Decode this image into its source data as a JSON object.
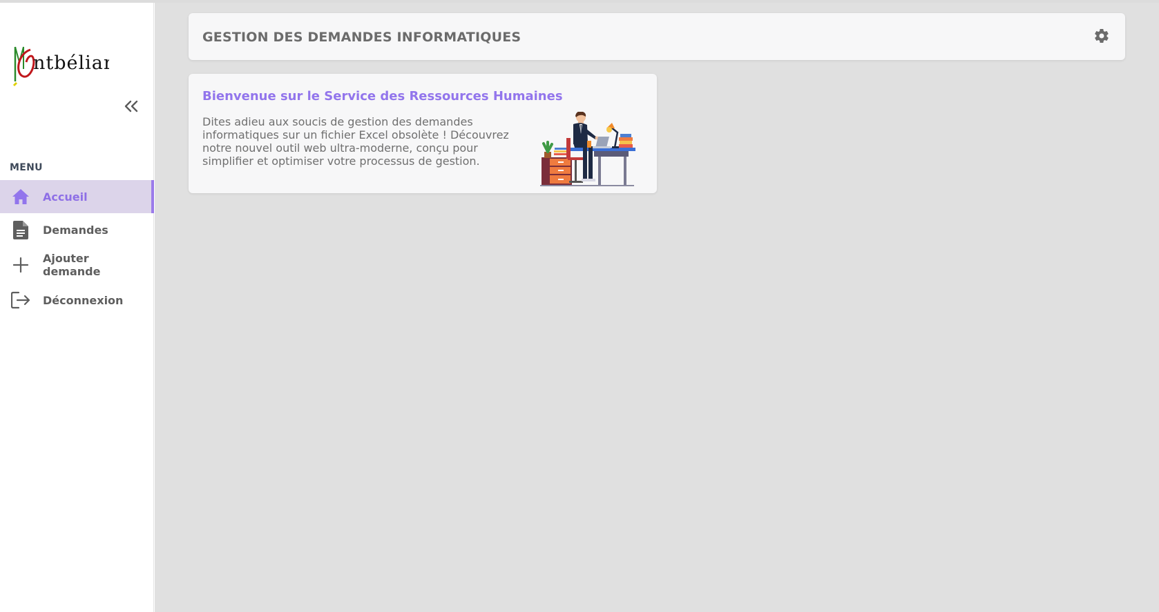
{
  "app": {
    "logo_text": "Montbéliard"
  },
  "sidebar": {
    "menu_label": "MENU",
    "collapse_icon": "double-chevron-left-icon",
    "items": [
      {
        "label": "Accueil",
        "icon": "home-icon",
        "active": true
      },
      {
        "label": "Demandes",
        "icon": "document-icon",
        "active": false
      },
      {
        "label": "Ajouter demande",
        "icon": "plus-icon",
        "active": false
      },
      {
        "label": "Déconnexion",
        "icon": "logout-icon",
        "active": false
      }
    ]
  },
  "header": {
    "title": "GESTION DES DEMANDES INFORMATIQUES",
    "settings_icon": "gear-icon"
  },
  "welcome_card": {
    "title": "Bienvenue sur le Service des Ressources Humaines",
    "text": "Dites adieu aux soucis de gestion des demandes informatiques sur un fichier Excel obsolète ! Découvrez notre nouvel outil web ultra-moderne, conçu pour simplifier et optimiser votre processus de gestion.",
    "illustration": "office-worker-at-desk-illustration"
  },
  "colors": {
    "accent": "#9275ec",
    "active_bg": "#dcd4ea",
    "main_bg": "#e0e0e0",
    "card_bg": "#f7f7f8"
  }
}
